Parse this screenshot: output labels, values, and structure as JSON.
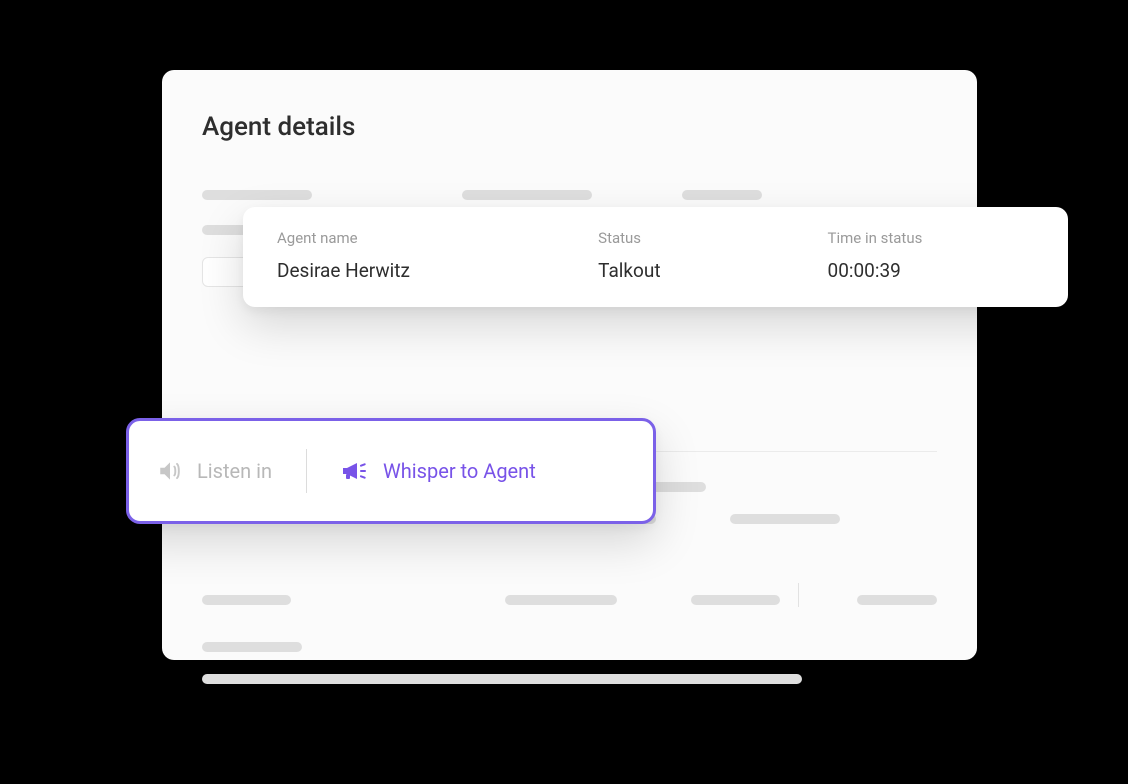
{
  "panel": {
    "title": "Agent details"
  },
  "status": {
    "agent_name_label": "Agent name",
    "agent_name_value": "Desirae Herwitz",
    "status_label": "Status",
    "status_value": "Talkout",
    "time_label": "Time in status",
    "time_value": "00:00:39"
  },
  "actions": {
    "listen_label": "Listen in",
    "whisper_label": "Whisper to Agent"
  },
  "colors": {
    "accent": "#7853e8",
    "border": "#7b61e8",
    "muted": "#b8b8b8"
  }
}
